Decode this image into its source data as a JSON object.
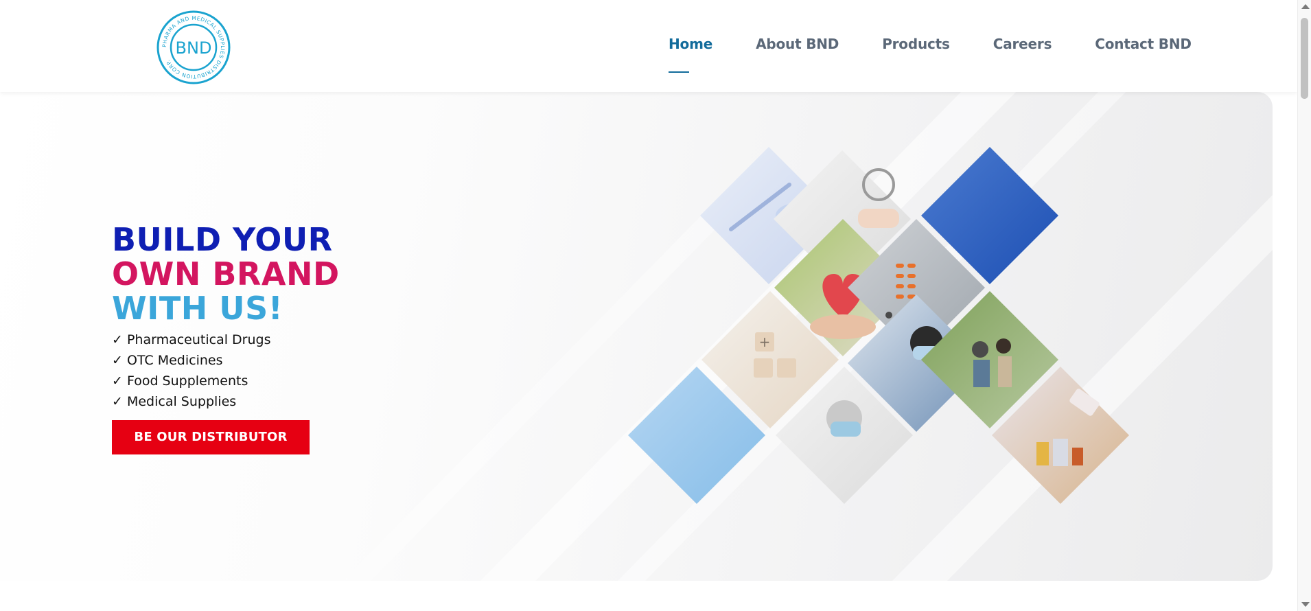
{
  "brand": {
    "logo_text": "BND",
    "logo_ring_text": "PHARMA AND MEDICAL SUPPLIES DISTRIBUTION CORP.",
    "primary_color": "#126b9b"
  },
  "nav": {
    "items": [
      {
        "label": "Home",
        "active": true
      },
      {
        "label": "About BND",
        "active": false
      },
      {
        "label": "Products",
        "active": false
      },
      {
        "label": "Careers",
        "active": false
      },
      {
        "label": "Contact BND",
        "active": false
      }
    ]
  },
  "hero": {
    "headline_line1": "BUILD YOUR",
    "headline_line2": "OWN BRAND",
    "headline_line3": "WITH US!",
    "checklist": [
      "✓ Pharmaceutical Drugs",
      "✓ OTC Medicines",
      "✓ Food Supplements",
      "✓ Medical Supplies"
    ],
    "cta_label": "BE OUR DISTRIBUTOR",
    "colors": {
      "line1": "#0f1fb3",
      "line2": "#d3155f",
      "line3": "#3ba6da",
      "cta": "#e60012"
    }
  }
}
